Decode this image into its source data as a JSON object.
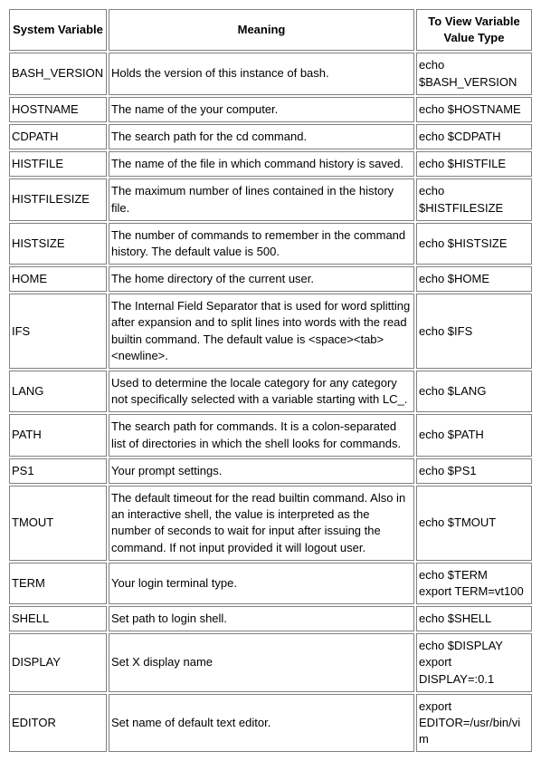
{
  "headers": {
    "variable": "System Variable",
    "meaning": "Meaning",
    "view": "To View Variable Value Type"
  },
  "rows": [
    {
      "variable": "BASH_VERSION",
      "meaning": "Holds the version of this instance of bash.",
      "view": "echo $BASH_VERSION"
    },
    {
      "variable": "HOSTNAME",
      "meaning": "The name of the your computer.",
      "view": "echo $HOSTNAME"
    },
    {
      "variable": "CDPATH",
      "meaning": "The search path for the cd command.",
      "view": "echo $CDPATH"
    },
    {
      "variable": "HISTFILE",
      "meaning": "The name of the file in which command history is saved.",
      "view": "echo $HISTFILE"
    },
    {
      "variable": "HISTFILESIZE",
      "meaning": "The maximum number of lines contained in the history file.",
      "view": "echo $HISTFILESIZE"
    },
    {
      "variable": "HISTSIZE",
      "meaning": "The number of commands to remember in the command history. The default value is 500.",
      "view": "echo $HISTSIZE"
    },
    {
      "variable": "HOME",
      "meaning": "The home directory of the current user.",
      "view": "echo $HOME"
    },
    {
      "variable": "IFS",
      "meaning": "The Internal Field Separator that is used for word splitting after expansion and to split lines into words with the read builtin command. The default value is <space><tab><newline>.",
      "view": "echo $IFS"
    },
    {
      "variable": "LANG",
      "meaning": "Used to determine the locale category for any category not specifically selected with a variable starting with LC_.",
      "view": "echo $LANG"
    },
    {
      "variable": "PATH",
      "meaning": "The search path for commands. It is a colon-separated list of directories in which the shell looks for commands.",
      "view": "echo $PATH"
    },
    {
      "variable": "PS1",
      "meaning": "Your prompt settings.",
      "view": "echo $PS1"
    },
    {
      "variable": "TMOUT",
      "meaning": "The default timeout for the read builtin command. Also in an interactive shell, the value is interpreted as the number of seconds to wait for input after issuing the command. If not input provided it will logout user.",
      "view": "echo $TMOUT"
    },
    {
      "variable": "TERM",
      "meaning": "Your login terminal type.",
      "view": "echo $TERM\nexport TERM=vt100"
    },
    {
      "variable": "SHELL",
      "meaning": "Set path to login shell.",
      "view": "echo $SHELL"
    },
    {
      "variable": "DISPLAY",
      "meaning": "Set X display name",
      "view": "echo $DISPLAY\nexport DISPLAY=:0.1"
    },
    {
      "variable": "EDITOR",
      "meaning": "Set name of default text editor.",
      "view": "export EDITOR=/usr/bin/vim"
    }
  ]
}
